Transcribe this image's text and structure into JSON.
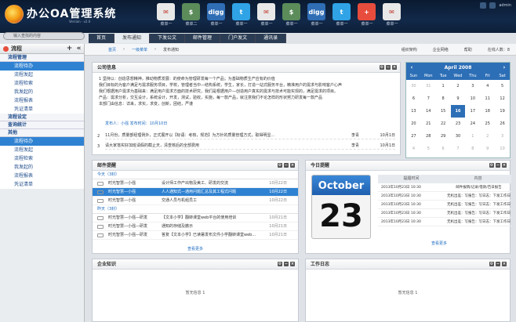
{
  "header": {
    "title": "办公OA管理系统",
    "subtitle": "Version · v2.0",
    "apps": [
      {
        "icon": "mail-icon",
        "label": "菜单一",
        "color": "#e8e8e8",
        "glyph": "✉"
      },
      {
        "icon": "dollar-icon",
        "label": "菜单二",
        "color": "#5b8c5a",
        "glyph": "$"
      },
      {
        "icon": "digg-icon",
        "label": "菜单一",
        "color": "#2f6db5",
        "glyph": "digg"
      },
      {
        "icon": "twitter-icon",
        "label": "菜单一",
        "color": "#2fa3e6",
        "glyph": "t"
      },
      {
        "icon": "mail-icon",
        "label": "菜单一",
        "color": "#e8e8e8",
        "glyph": "✉"
      },
      {
        "icon": "dollar-icon",
        "label": "菜单一",
        "color": "#5b8c5a",
        "glyph": "$"
      },
      {
        "icon": "digg-icon",
        "label": "菜单一",
        "color": "#2f6db5",
        "glyph": "digg"
      },
      {
        "icon": "twitter-icon",
        "label": "菜单一",
        "color": "#2fa3e6",
        "glyph": "t"
      },
      {
        "icon": "plus-icon",
        "label": "菜单一",
        "color": "#e74c3c",
        "glyph": "+"
      },
      {
        "icon": "mail-icon",
        "label": "菜单一",
        "color": "#e8e8e8",
        "glyph": "✉"
      }
    ],
    "user": "admin"
  },
  "search": {
    "placeholder": "输入查找的内容"
  },
  "tabs": [
    "首页",
    "发布通知",
    "下发公文",
    "邮件管理",
    "门户发文",
    "通讯录"
  ],
  "sidebar": {
    "title": "流程",
    "groups": [
      {
        "label": "流程管理",
        "items": [
          "流程待办",
          "流程发起",
          "流程检索",
          "我发起的",
          "流程报表",
          "凭证清单"
        ]
      },
      {
        "label": "流程设定",
        "items": []
      },
      {
        "label": "查询统计",
        "items": []
      },
      {
        "label": "其他",
        "items": [
          "流程待办",
          "流程发起",
          "流程检索",
          "我发起的",
          "流程报表",
          "凭证清单"
        ]
      }
    ]
  },
  "breadcrumb": [
    "首页",
    "一级菜单",
    "发布通知"
  ],
  "toplinks": [
    "组织架构",
    "企业网络",
    "帮助",
    "在线人数"
  ],
  "online_count": "8",
  "notice": {
    "title": "公司信息",
    "lines": [
      "1   坚持以：创造思想精神，推动物质发展：的使命为管理研发每一个产品；为基础物质生产应有的价值",
      "    我们目标的为客户满足与需求服务项目，学校，管理者当中—结构系统，学生，家长，打造一站式服务平台，精准用户的需求与影响客户心声",
      "    我们根据用户需求为基础来：满足用户需求方面的技术研究，我们是根据用户—创造用户真实的需求与技术可能实现的，满足需求的项目。",
      "    产品：需求分析，交互设计，系统设计，开发，测试，验收，实施，每一款产品，就注意我们不论怎样的形状努力研发每一款产品",
      "    本部门由信息：详来，求实，求变，创新，团结，严谨"
    ],
    "publisher": "发布人：小强    发布时间：10月10日",
    "rows": [
      {
        "n": "2",
        "text": "11月份，质量部经理例外，正式展开以【标语：考核，规范】为方针的质量管理方式，取得明显...",
        "author": "李青",
        "date": "10月1日"
      },
      {
        "n": "3",
        "text": "请大家落实好加班请假的截止天，清查核后的全部费用",
        "author": "李青",
        "date": "10月1日"
      }
    ]
  },
  "calendar": {
    "month": "April 2008",
    "dow": [
      "Sun",
      "Mon",
      "Tue",
      "Wed",
      "Thu",
      "Fri",
      "Sat"
    ],
    "weeks": [
      [
        "30",
        "31",
        "1",
        "2",
        "3",
        "4",
        "5"
      ],
      [
        "6",
        "7",
        "8",
        "9",
        "10",
        "11",
        "12"
      ],
      [
        "13",
        "14",
        "15",
        "16",
        "17",
        "18",
        "19"
      ],
      [
        "20",
        "21",
        "22",
        "23",
        "24",
        "25",
        "26"
      ],
      [
        "27",
        "28",
        "29",
        "30",
        "1",
        "2",
        "3"
      ],
      [
        "4",
        "5",
        "6",
        "7",
        "8",
        "9",
        "10"
      ]
    ],
    "today": "16"
  },
  "mail": {
    "title": "邮件提醒",
    "today_label": "今天（3封）",
    "yesterday_label": "昨天（3封）",
    "today": [
      {
        "from": "时光智慧—小强",
        "subject": "设计师工作产出物及美工、研发的交流",
        "date": "10月22日"
      },
      {
        "from": "时光智慧—小强",
        "subject": "人人通知式—通用问题汇总及其工程式问题",
        "date": "10月22日"
      },
      {
        "from": "时光智慧—小强",
        "subject": "交通人员与机组员工",
        "date": "10月22日"
      }
    ],
    "yesterday": [
      {
        "from": "时光智慧—小强—研发",
        "subject": "【文本小学】翻转课堂web平台的使用培训",
        "date": "10月21日"
      },
      {
        "from": "时光智慧—小强—研发",
        "subject": "通知的存储及撤示",
        "date": "10月21日"
      },
      {
        "from": "时光智慧—小强—研发",
        "subject": "答复【文本小学】已读署发布文件小学翻转课堂web...",
        "date": "10月21日"
      }
    ],
    "more": "查看更多"
  },
  "today": {
    "title": "今日提醒",
    "month": "October",
    "day": "23",
    "cols": [
      "提醒时间",
      "内容"
    ],
    "rows": [
      {
        "time": "2013年10月23日 10:30",
        "content": "邮件报销/记录/借款/百日报告"
      },
      {
        "time": "2013年10月23日 10:30",
        "content": "无机出差：写报告：写日志：下发工作日"
      },
      {
        "time": "2013年10月23日 10:30",
        "content": "无机出差：写报告：写日志：下发工作日"
      },
      {
        "time": "2013年10月23日 10:30",
        "content": "无机出差：写报告：写日志：下发工作日"
      },
      {
        "time": "2013年10月23日 10:30",
        "content": "无机出差：写报告：写日志：下发工作日"
      }
    ],
    "more": "查看更多"
  },
  "knowledge": {
    "title": "企业知识",
    "empty": "暂无信息 1"
  },
  "worklog": {
    "title": "工作日志",
    "empty": "暂无信息 1"
  }
}
